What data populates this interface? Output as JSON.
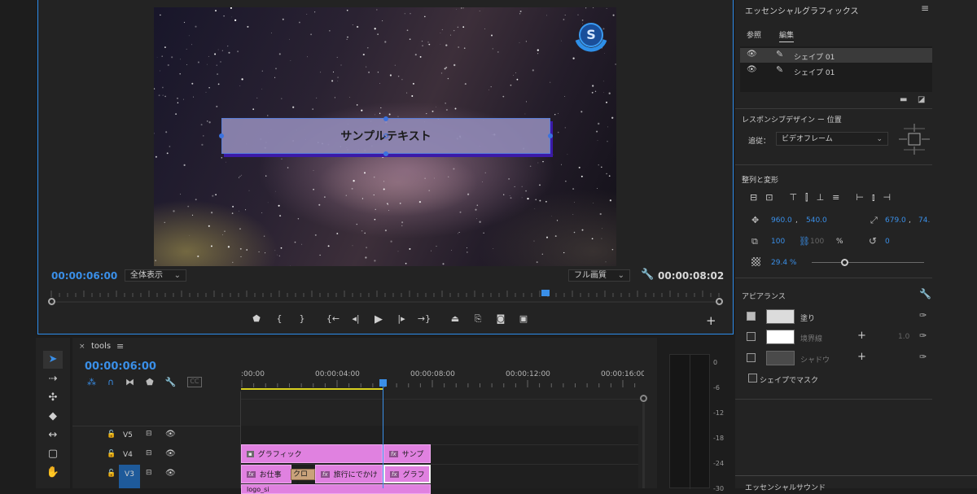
{
  "program_monitor": {
    "overlay_text": "サンプルテキスト",
    "current_timecode": "00:00:06:00",
    "zoom_label": "全体表示",
    "quality_label": "フル画質",
    "duration_timecode": "00:00:08:02",
    "playhead_fraction": 0.74,
    "logo_letter": "S"
  },
  "essential_graphics": {
    "title": "エッセンシャルグラフィックス",
    "tab_browse": "参照",
    "tab_edit": "編集",
    "layers": [
      {
        "name": "シェイプ 01",
        "selected": true
      },
      {
        "name": "シェイプ 01",
        "selected": false
      }
    ],
    "responsive_title": "レスポンシブデザイン ー 位置",
    "follow_label": "追従：",
    "follow_value": "ビデオフレーム",
    "align_title": "整列と変形",
    "pos_x": "960.0",
    "pos_sep": ",",
    "pos_y": "540.0",
    "anchor_x": "679.0",
    "anchor_sep": ",",
    "anchor_y": "74.",
    "scale": "100",
    "scale_h": "100",
    "scale_unit": "%",
    "rotation": "0",
    "opacity": "29.4 %",
    "opacity_fraction": 0.29,
    "appearance_title": "アピアランス",
    "fill_label": "塗り",
    "fill_color": "#dcdcdc",
    "stroke_label": "境界線",
    "stroke_value": "1.0",
    "stroke_color": "#ffffff",
    "shadow_label": "シャドウ",
    "shadow_color": "#4a4a4a",
    "mask_label": "シェイプでマスク",
    "bottom_title": "エッセンシャルサウンド"
  },
  "timeline": {
    "close_glyph": "×",
    "sequence_name": "tools",
    "timecode": "00:00:06:00",
    "ruler_labels": [
      ":00:00",
      "00:00:04:00",
      "00:00:08:00",
      "00:00:12:00",
      "00:00:16:00"
    ],
    "tracks": [
      "V5",
      "V4",
      "V3"
    ],
    "clips": {
      "v4_a": "グラフィック",
      "v4_b": "サンプ",
      "v3_a": "お仕事",
      "v3_cross": "クロス",
      "v3_b": "旅行にでかけ",
      "v3_c": "グラフ",
      "v2_a": "logo_si"
    },
    "fx_label": "fx"
  },
  "meters": {
    "db_labels": [
      "0",
      "-6",
      "-12",
      "-18",
      "-24",
      "-30"
    ]
  },
  "colors": {
    "accent": "#2d8ceb",
    "clip_pink": "#e081e0",
    "track_active": "#1e5a9a"
  }
}
